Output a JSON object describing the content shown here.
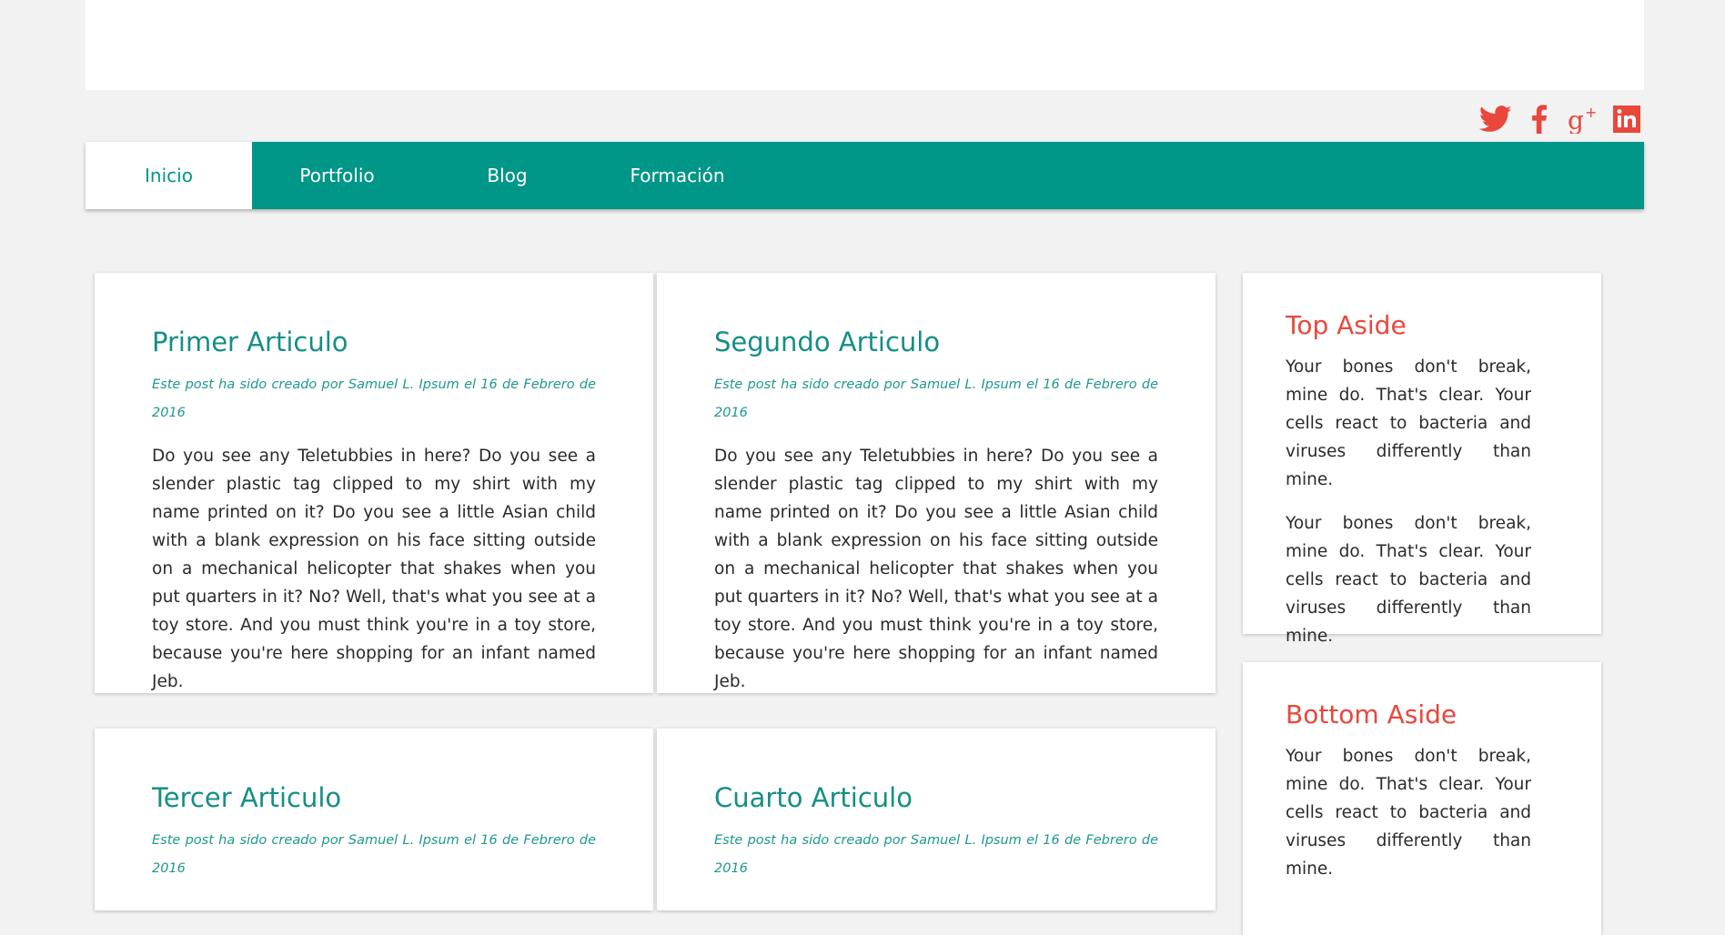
{
  "nav": {
    "items": [
      {
        "label": "Inicio",
        "active": true
      },
      {
        "label": "Portfolio",
        "active": false
      },
      {
        "label": "Blog",
        "active": false
      },
      {
        "label": "Formación",
        "active": false
      }
    ]
  },
  "social": {
    "icons": [
      "twitter-icon",
      "facebook-icon",
      "google-plus-icon",
      "linkedin-icon"
    ],
    "color": "#e9473c"
  },
  "colors": {
    "accent": "#009688",
    "aside_title": "#e9473c",
    "background": "#f2f2f2"
  },
  "articles": [
    {
      "title": "Primer Articulo",
      "meta": "Este post ha sido creado por Samuel L. Ipsum el 16 de Febrero de 2016",
      "body": "Do you see any Teletubbies in here? Do you see a slender plastic tag clipped to my shirt with my name printed on it? Do you see a little Asian child with a blank expression on his face sitting outside on a mechanical helicopter that shakes when you put quarters in it? No? Well, that's what you see at a toy store. And you must think you're in a toy store, because you're here shopping for an infant named Jeb."
    },
    {
      "title": "Segundo Articulo",
      "meta": "Este post ha sido creado por Samuel L. Ipsum el 16 de Febrero de 2016",
      "body": "Do you see any Teletubbies in here? Do you see a slender plastic tag clipped to my shirt with my name printed on it? Do you see a little Asian child with a blank expression on his face sitting outside on a mechanical helicopter that shakes when you put quarters in it? No? Well, that's what you see at a toy store. And you must think you're in a toy store, because you're here shopping for an infant named Jeb."
    },
    {
      "title": "Tercer Articulo",
      "meta": "Este post ha sido creado por Samuel L. Ipsum el 16 de Febrero de 2016",
      "body": ""
    },
    {
      "title": "Cuarto Articulo",
      "meta": "Este post ha sido creado por Samuel L. Ipsum el 16 de Febrero de 2016",
      "body": ""
    }
  ],
  "asides": {
    "top": {
      "title": "Top Aside",
      "paragraphs": [
        "Your bones don't break, mine do. That's clear. Your cells react to bacteria and viruses differently than mine.",
        "Your bones don't break, mine do. That's clear. Your cells react to bacteria and viruses differently than mine."
      ]
    },
    "bottom": {
      "title": "Bottom Aside",
      "paragraphs": [
        "Your bones don't break, mine do. That's clear. Your cells react to bacteria and viruses differently than mine."
      ]
    }
  }
}
